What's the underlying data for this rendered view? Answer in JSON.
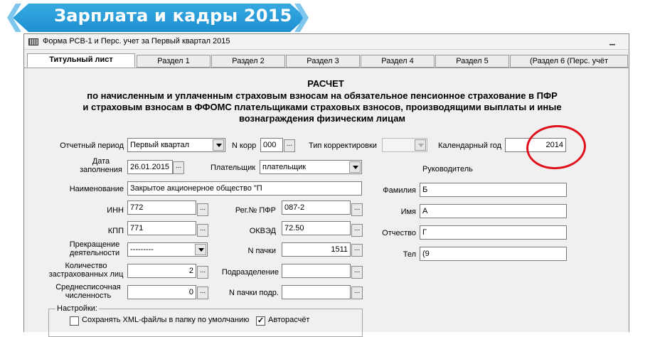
{
  "banner": {
    "title": "Зарплата и кадры 2015"
  },
  "window": {
    "title": "Форма РСВ-1 и Перс. учет за Первый квартал 2015"
  },
  "tabs": [
    "Титульный лист",
    "Раздел 1",
    "Раздел 2",
    "Раздел 3",
    "Раздел 4",
    "Раздел 5",
    "(Раздел 6 (Перс. учёт"
  ],
  "header": {
    "title": "РАСЧЕТ",
    "line1": "по начисленным и уплаченным страховым взносам на обязательное пенсионное страхование в ПФР",
    "line2": "и страховым взносам  в ФФОМС  плательщиками страховых взносов, производящими выплаты и иные",
    "line3": "вознаграждения физическим лицам"
  },
  "form": {
    "period_label": "Отчетный период",
    "period_value": "Первый квартал",
    "ncorr_label": "N корр",
    "ncorr_value": "000",
    "corr_type_label": "Тип корректировки",
    "corr_type_value": "",
    "year_label": "Календарный год",
    "year_value": "2014",
    "fill_date_label": "Дата заполнения",
    "fill_date_value": "26.01.2015",
    "payer_label": "Плательщик",
    "payer_value": "плательщик",
    "name_label": "Наименование",
    "name_value": "Закрытое акционерное общество \"П",
    "inn_label": "ИНН",
    "inn_value": "772",
    "kpp_label": "КПП",
    "kpp_value": "771",
    "regpfr_label": "Рег.№ ПФР",
    "regpfr_value": "087-2",
    "okved_label": "ОКВЭД",
    "okved_value": "72.50",
    "stop_label": "Прекращение деятельности",
    "stop_value": "---------",
    "npack_label": "N пачки",
    "npack_value": "1511",
    "insured_label": "Количество застрахованных лиц",
    "insured_value": "2",
    "subdiv_label": "Подразделение",
    "subdiv_value": "",
    "avg_label": "Среднесписочная численность",
    "avg_value": "0",
    "npack_sub_label": "N пачки подр.",
    "npack_sub_value": ""
  },
  "director": {
    "heading": "Руководитель",
    "surname_label": "Фамилия",
    "surname_value": "Б",
    "name_label": "Имя",
    "name_value": "А",
    "patronymic_label": "Отчество",
    "patronymic_value": "Г",
    "phone_label": "Тел",
    "phone_value": "(9"
  },
  "settings": {
    "title": "Настройки:",
    "save_xml_label": "Сохранять XML-файлы в папку по умолчанию",
    "save_xml_checked": false,
    "auto_calc_label": "Авторасчёт",
    "auto_calc_checked": true
  },
  "colors": {
    "banner": "#2a9ad8",
    "annotation": "#e0101c"
  }
}
